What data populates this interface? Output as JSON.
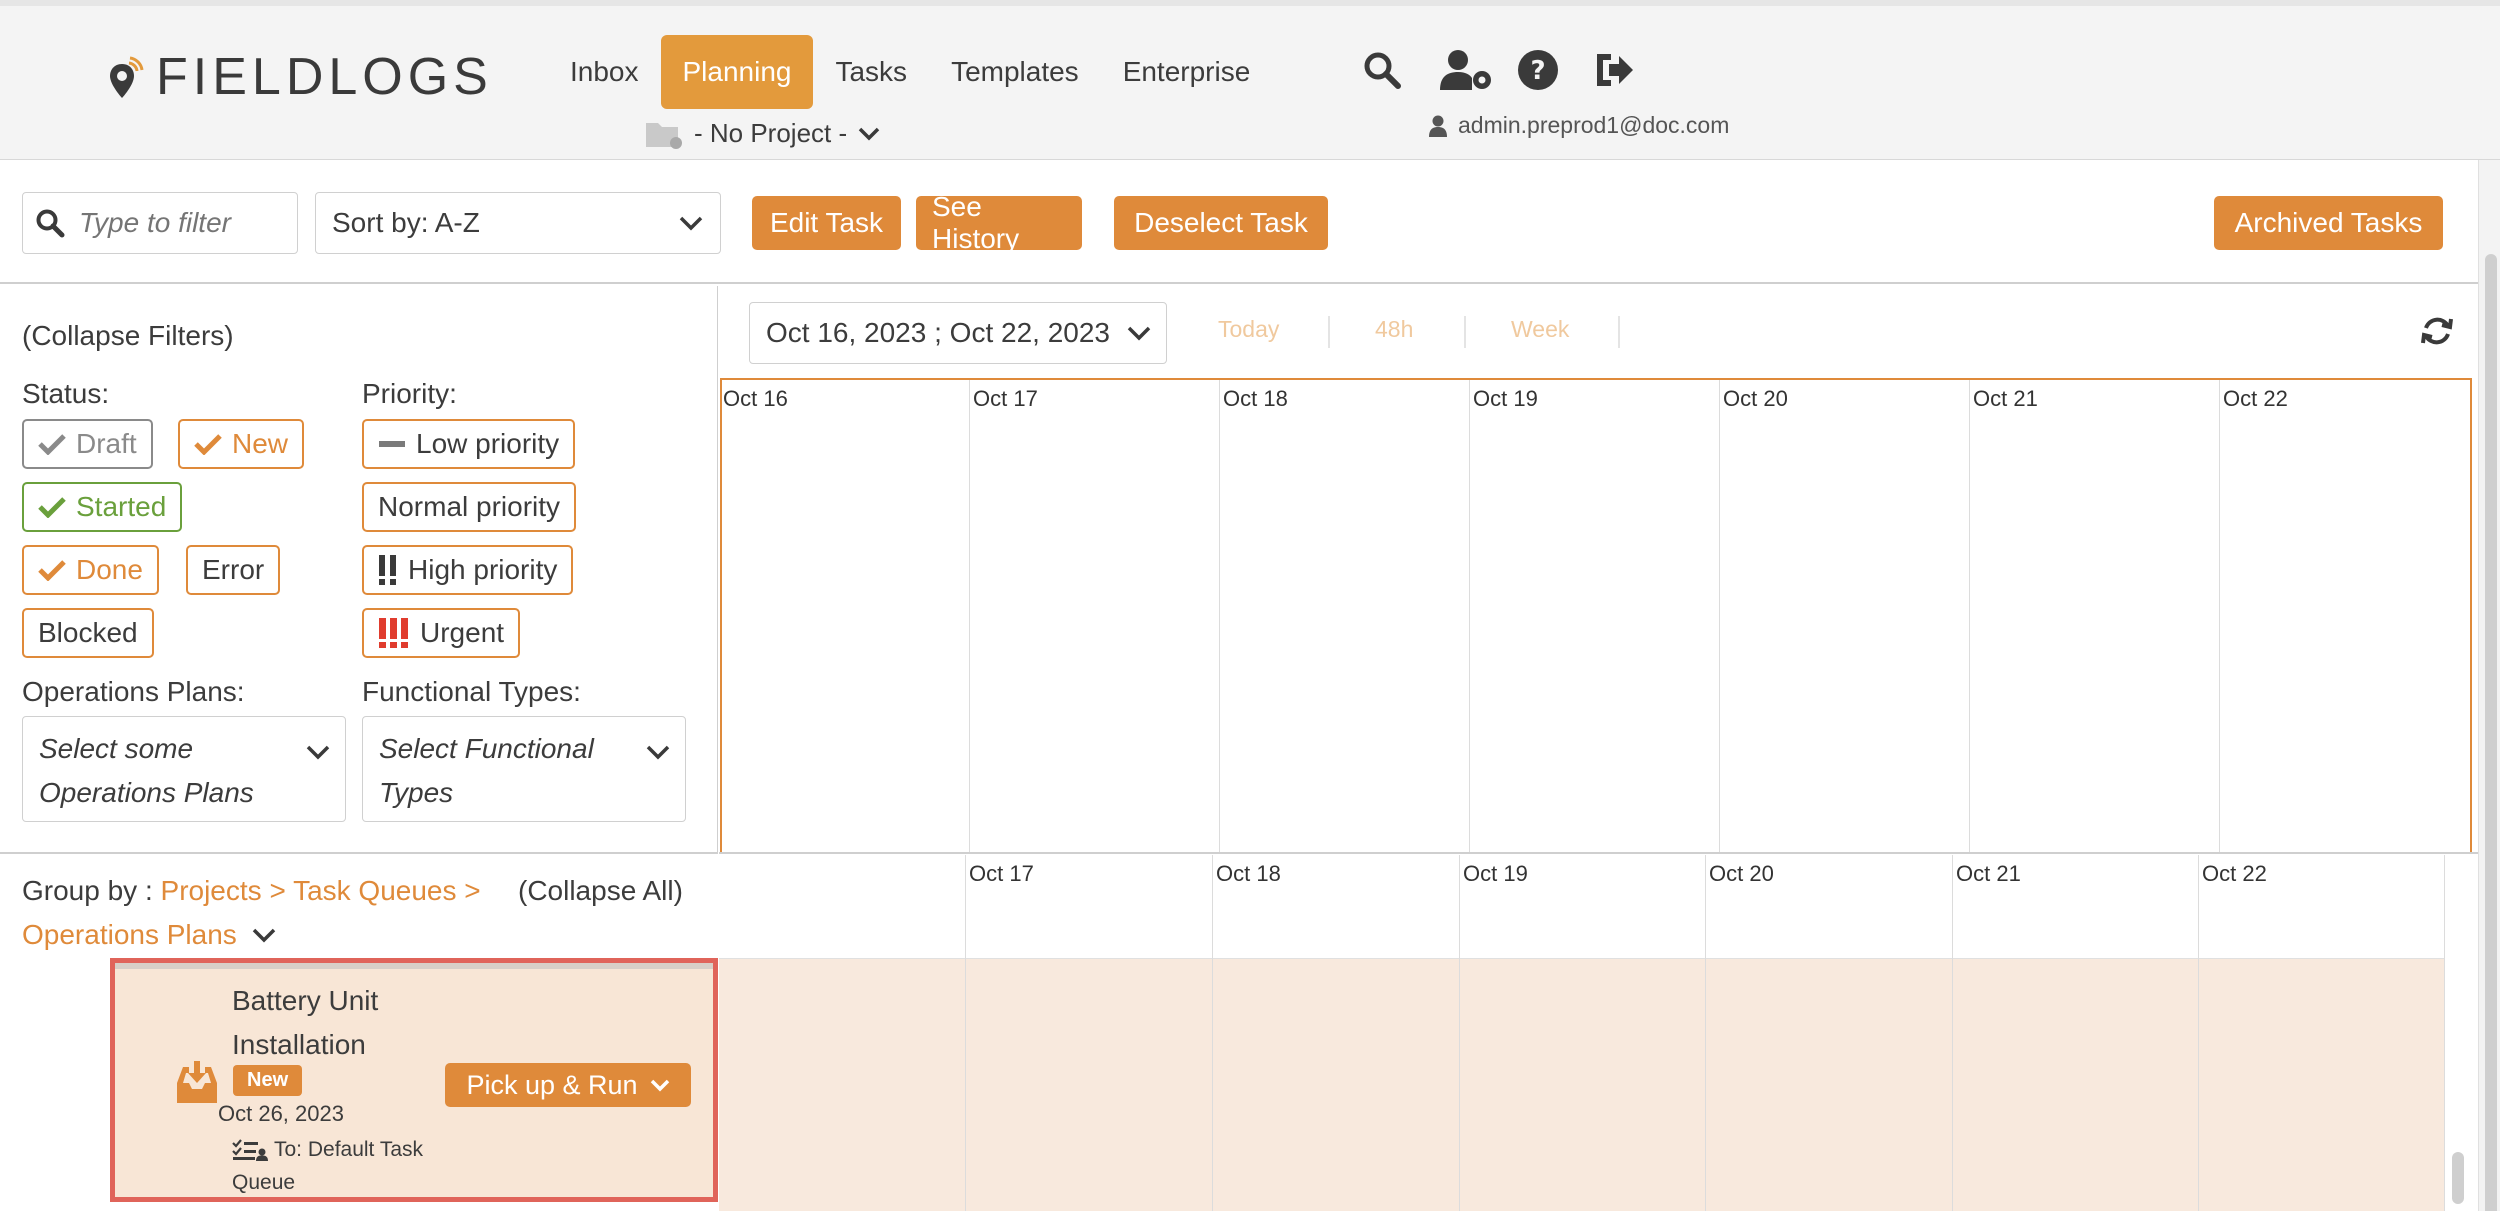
{
  "app": {
    "logo_text": "FIELDLOGS"
  },
  "nav": {
    "items": [
      {
        "label": "Inbox"
      },
      {
        "label": "Planning",
        "active": true
      },
      {
        "label": "Tasks"
      },
      {
        "label": "Templates"
      },
      {
        "label": "Enterprise"
      }
    ],
    "icons": [
      "search-icon",
      "user-settings-icon",
      "help-icon",
      "logout-icon"
    ]
  },
  "project": {
    "label": "- No Project -"
  },
  "user": {
    "email": "admin.preprod1@doc.com"
  },
  "toolbar": {
    "filter_placeholder": "Type to filter",
    "sort_label": "Sort by: A-Z",
    "edit_task": "Edit Task",
    "see_history": "See History",
    "deselect_task": "Deselect Task",
    "archived_tasks": "Archived Tasks"
  },
  "filters": {
    "collapse_label": "(Collapse Filters)",
    "status_label": "Status:",
    "priority_label": "Priority:",
    "status": [
      "Draft",
      "New",
      "Started",
      "Done",
      "Error",
      "Blocked"
    ],
    "priority": [
      "Low priority",
      "Normal priority",
      "High priority",
      "Urgent"
    ],
    "operations_plans_label": "Operations Plans:",
    "operations_plans_placeholder_1": "Select some",
    "operations_plans_placeholder_2": "Operations Plans",
    "functional_types_label": "Functional Types:",
    "functional_types_placeholder_1": "Select Functional",
    "functional_types_placeholder_2": "Types"
  },
  "timeline": {
    "range": "Oct 16, 2023 ; Oct 22, 2023",
    "quick": [
      "Today",
      "48h",
      "Week"
    ],
    "days": [
      "Oct 16",
      "Oct 17",
      "Oct 18",
      "Oct 19",
      "Oct 20",
      "Oct 21",
      "Oct 22"
    ],
    "bottom_days": [
      "Oct 17",
      "Oct 18",
      "Oct 19",
      "Oct 20",
      "Oct 21",
      "Oct 22"
    ]
  },
  "group": {
    "prefix": "Group by : ",
    "link_1": "Projects > Task Queues >",
    "link_2": "Operations Plans",
    "collapse_all": "(Collapse All)"
  },
  "task": {
    "title": "Battery Unit Installation",
    "badge": "New",
    "date": "Oct 26, 2023",
    "queue": "To: Default Task Queue",
    "action": "Pick up & Run"
  },
  "colors": {
    "accent": "#df8a3a",
    "selected_border": "#e0645a",
    "started": "#6aa03c"
  }
}
